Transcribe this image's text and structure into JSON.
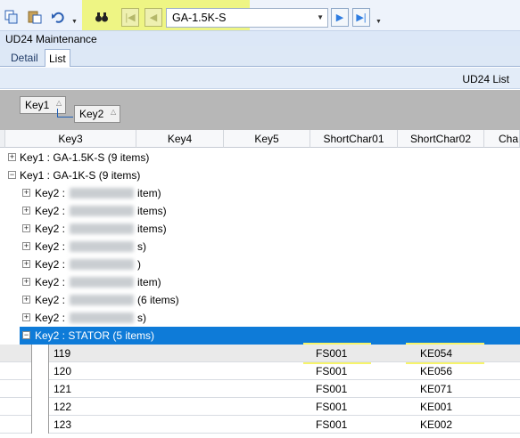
{
  "toolbar": {
    "copy_icon": "copy-icon",
    "paste_icon": "paste-icon",
    "undo_icon": "undo-icon",
    "search_icon": "binoculars-icon",
    "first_icon": "first-record-icon",
    "prev_icon": "previous-record-icon",
    "next_icon": "next-record-icon",
    "last_icon": "last-record-icon",
    "record_value": "GA-1.5K-S"
  },
  "window": {
    "title": "UD24 Maintenance"
  },
  "tabs": [
    {
      "label": "Detail"
    },
    {
      "label": "List"
    }
  ],
  "grid": {
    "caption": "UD24 List",
    "group_by": [
      {
        "label": "Key1"
      },
      {
        "label": "Key2"
      }
    ],
    "columns": [
      "Key3",
      "Key4",
      "Key5",
      "ShortChar01",
      "ShortChar02",
      "Cha"
    ],
    "groups": [
      {
        "text": "Key1 : GA-1.5K-S (9 items)",
        "toggle": "+"
      },
      {
        "text": "Key1 : GA-1K-S (9 items)",
        "toggle": "−"
      }
    ],
    "subgroups": [
      {
        "prefix": "Key2 :",
        "suffix": "item)"
      },
      {
        "prefix": "Key2 :",
        "suffix": "items)"
      },
      {
        "prefix": "Key2 :",
        "suffix": "items)"
      },
      {
        "prefix": "Key2 :",
        "suffix": "s)"
      },
      {
        "prefix": "Key2 :",
        "suffix": ")"
      },
      {
        "prefix": "Key2 :",
        "suffix": "item)"
      },
      {
        "prefix": "Key2 :",
        "suffix": "(6 items)"
      },
      {
        "prefix": "Key2 :",
        "suffix": "s)"
      }
    ],
    "selected_group": "Key2 : STATOR (5 items)",
    "rows": [
      {
        "key3": "119",
        "sc01": "FS001",
        "sc02": "KE054"
      },
      {
        "key3": "120",
        "sc01": "FS001",
        "sc02": "KE056"
      },
      {
        "key3": "121",
        "sc01": "FS001",
        "sc02": "KE071"
      },
      {
        "key3": "122",
        "sc01": "FS001",
        "sc02": "KE001"
      },
      {
        "key3": "123",
        "sc01": "FS001",
        "sc02": "KE002"
      }
    ]
  }
}
